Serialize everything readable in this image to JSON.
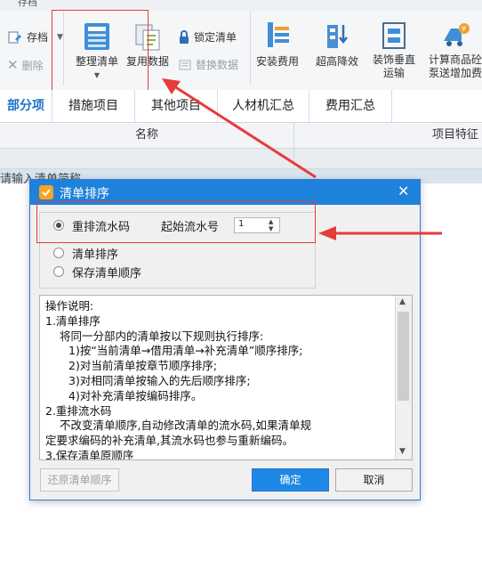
{
  "ribbon": {
    "top_partial": "存档",
    "save": "存档",
    "delete": "删除",
    "tidy_list": "整理清单",
    "reuse_data": "复用数据",
    "lock_list": "锁定清单",
    "replace_data": "替换数据",
    "install_cost": "安装费用",
    "height_reduction": "超高降效",
    "decor_transport_line1": "装饰垂直",
    "decor_transport_line2": "运输",
    "calc_pump_line1": "计算商品砼",
    "calc_pump_line2": "泵送增加费"
  },
  "tabs": [
    {
      "label": "部分项",
      "active": true
    },
    {
      "label": "措施项目",
      "active": false
    },
    {
      "label": "其他项目",
      "active": false
    },
    {
      "label": "人材机汇总",
      "active": false
    },
    {
      "label": "费用汇总",
      "active": false
    }
  ],
  "grid": {
    "col_name": "名称",
    "col_feature": "项目特征",
    "placeholder_row": "请输入清单简称"
  },
  "dialog": {
    "title": "清单排序",
    "options": [
      {
        "label": "重排流水码",
        "selected": true
      },
      {
        "label": "清单排序",
        "selected": false
      },
      {
        "label": "保存清单顺序",
        "selected": false
      }
    ],
    "start_serial_label": "起始流水号",
    "start_serial_value": "1",
    "description_lines": [
      "操作说明:",
      "1.清单排序",
      "  将同一分部内的清单按以下规则执行排序:",
      "    1)按“当前清单→借用清单→补充清单”顺序排序;",
      "    2)对当前清单按章节顺序排序;",
      "    3)对相同清单按输入的先后顺序排序;",
      "    4)对补充清单按编码排序。",
      "2.重排流水码",
      "  不改变清单顺序,自动修改清单的流水码,如果清单规",
      "定要求编码的补充清单,其流水码也参与重新编码。",
      "3.保存清单原顺序"
    ],
    "restore_button": "还原清单顺序",
    "ok_button": "确定",
    "cancel_button": "取消"
  },
  "colors": {
    "dialog_title_bg": "#1e82dc",
    "primary_button": "#1e88e5",
    "annotation_red": "#e63b3b",
    "active_tab": "#1a73c8"
  }
}
